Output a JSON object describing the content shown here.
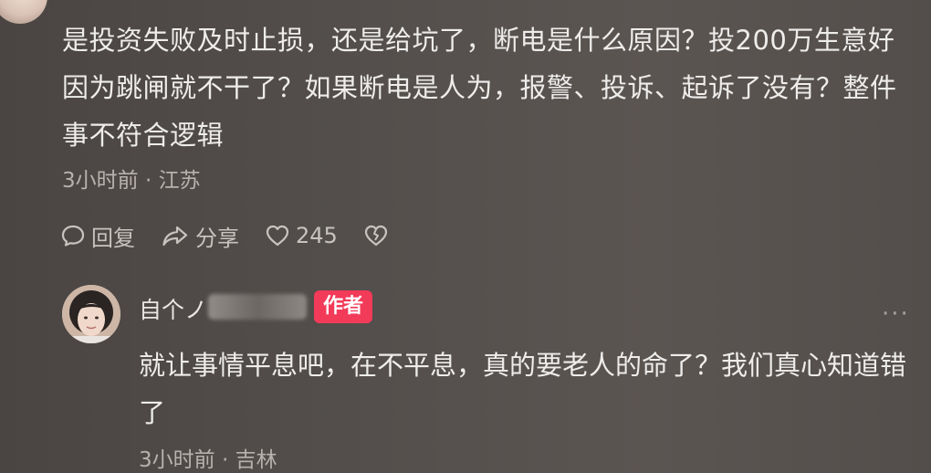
{
  "comment": {
    "text": "是投资失败及时止损，还是给坑了，断电是什么原因？投200万生意好因为跳闸就不干了？如果断电是人为，报警、投诉、起诉了没有？整件事不符合逻辑",
    "meta": "3小时前 · 江苏",
    "actions": {
      "reply_label": "回复",
      "share_label": "分享",
      "like_count": "245"
    }
  },
  "reply": {
    "author_name": "自个ノ",
    "author_badge": "作者",
    "text": "就让事情平息吧，在不平息，真的要老人的命了？我们真心知道错了",
    "meta": "3小时前 · 吉林"
  },
  "colors": {
    "badge": "#f23a59",
    "background": "#55504d"
  },
  "icons": [
    "comment-bubble-icon",
    "share-arrow-icon",
    "heart-icon",
    "broken-heart-icon",
    "more-dots-icon"
  ]
}
